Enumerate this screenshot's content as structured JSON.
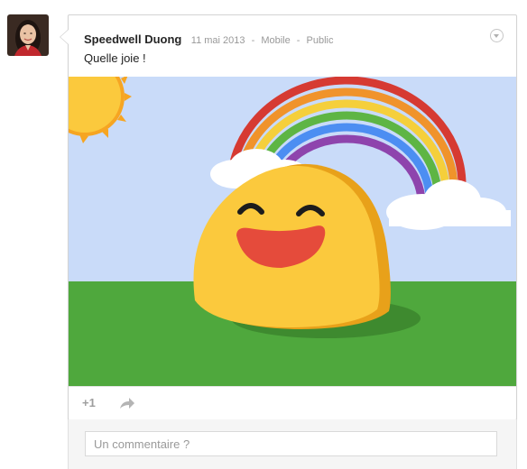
{
  "post": {
    "author": "Speedwell Duong",
    "date": "11 mai 2013",
    "source": "Mobile",
    "visibility": "Public",
    "text": "Quelle joie !"
  },
  "actions": {
    "plus_one": "+1",
    "share_icon": "share-arrow-icon"
  },
  "comment": {
    "placeholder": "Un commentaire ?",
    "value": ""
  },
  "image": {
    "subject": "smiling-blob-emoji-with-rainbow",
    "colors": {
      "sky": "#c9dbf9",
      "grass": "#4fa83d",
      "blob": "#fbc93d",
      "mouth": "#e54b3b",
      "sun": "#fbc93d"
    }
  }
}
